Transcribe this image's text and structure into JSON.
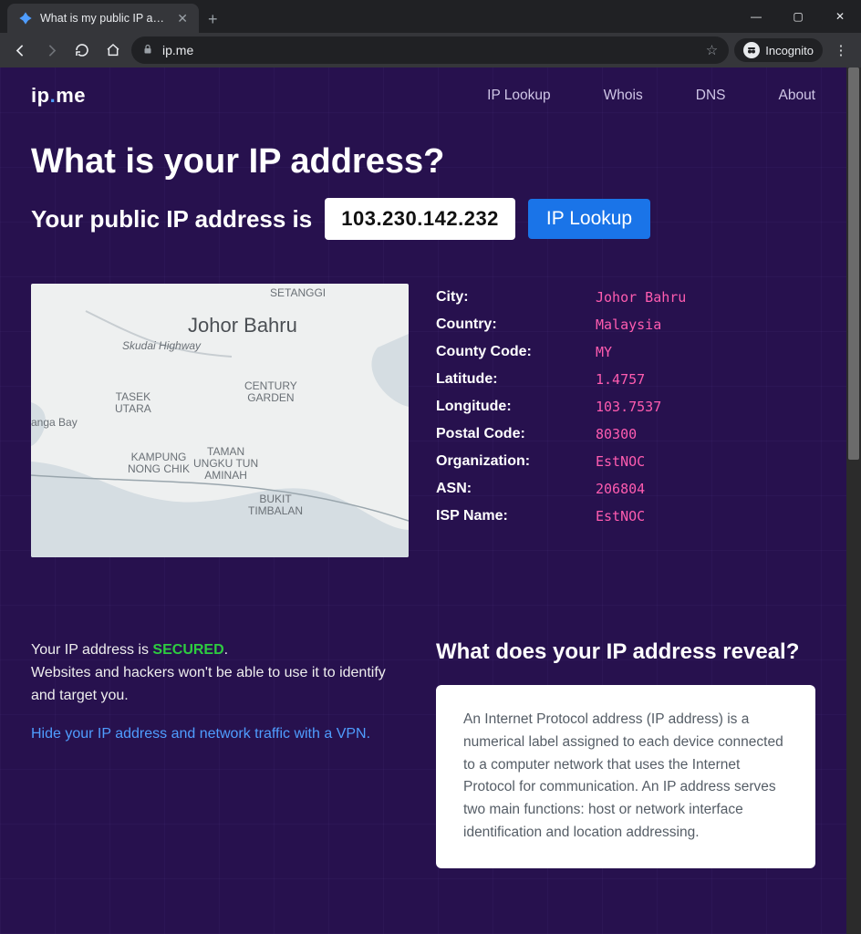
{
  "browser": {
    "tab_title": "What is my public IP address - IP",
    "url": "ip.me",
    "incognito_label": "Incognito"
  },
  "nav": {
    "logo_left": "ip",
    "logo_right": "me",
    "links": [
      "IP Lookup",
      "Whois",
      "DNS",
      "About"
    ]
  },
  "hero": {
    "headline": "What is your IP address?",
    "sublabel": "Your public IP address is",
    "ip": "103.230.142.232",
    "lookup_btn": "IP Lookup"
  },
  "map": {
    "big_label": "Johor Bahru",
    "labels": {
      "setanggi": "SETANGGI",
      "skudai": "Skudai Highway",
      "century": "CENTURY\nGARDEN",
      "tasek": "TASEK\nUTARA",
      "danga": "anga Bay",
      "nongchik": "KAMPUNG\nNONG CHIK",
      "taman": "TAMAN\nUNGKU TUN\nAMINAH",
      "bukit": "BUKIT\nTIMBALAN"
    }
  },
  "details": [
    {
      "k": "City:",
      "v": "Johor Bahru"
    },
    {
      "k": "Country:",
      "v": "Malaysia"
    },
    {
      "k": "County Code:",
      "v": "MY"
    },
    {
      "k": "Latitude:",
      "v": "1.4757"
    },
    {
      "k": "Longitude:",
      "v": "103.7537"
    },
    {
      "k": "Postal Code:",
      "v": "80300"
    },
    {
      "k": "Organization:",
      "v": "EstNOC"
    },
    {
      "k": "ASN:",
      "v": "206804"
    },
    {
      "k": "ISP Name:",
      "v": "EstNOC"
    }
  ],
  "lower": {
    "left_line1a": "Your IP address is ",
    "left_secured": "SECURED",
    "left_line1b": ".",
    "left_line2": "Websites and hackers won't be able to use it to identify and target you.",
    "left_link": "Hide your IP address and network traffic with a VPN.",
    "right_heading": "What does your IP address reveal?",
    "card_text": "An Internet Protocol address (IP address) is a numerical label assigned to each device connected to a computer network that uses the Internet Protocol for communication. An IP address serves two main functions: host or network interface identification and location addressing."
  }
}
